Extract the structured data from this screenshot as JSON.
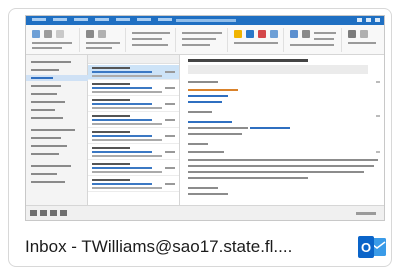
{
  "caption": {
    "text": "Inbox - TWilliams@sao17.state.fl...."
  },
  "app_icon": {
    "name": "outlook-icon",
    "letter": "O",
    "color_primary": "#0a64c9",
    "color_secondary": "#3a9be8"
  },
  "colors": {
    "ribbon_blue": "#1f6fc2",
    "selection": "#cde3f7"
  }
}
